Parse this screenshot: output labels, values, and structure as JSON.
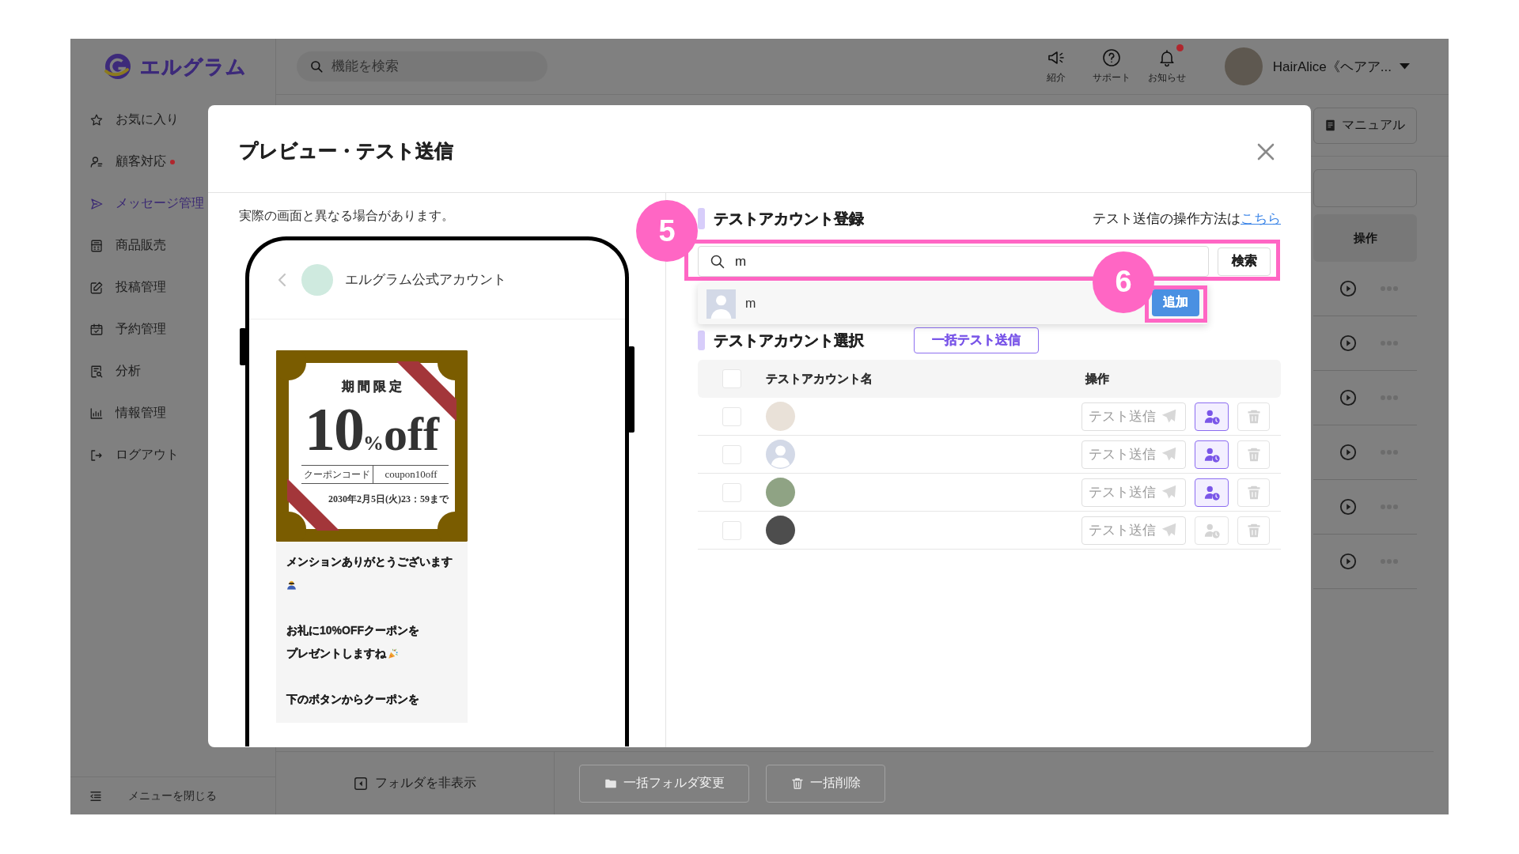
{
  "app": {
    "logo": "エルグラム",
    "search": {
      "placeholder": "機能を検索"
    }
  },
  "header_actions": [
    {
      "label": "紹介",
      "badge": false
    },
    {
      "label": "サポート",
      "badge": false
    },
    {
      "label": "お知らせ",
      "badge": true
    }
  ],
  "account": {
    "name": "HairAlice《ヘアア..."
  },
  "sidebar": {
    "items": [
      {
        "label": "お気に入り",
        "selected": false,
        "alert": false
      },
      {
        "label": "顧客対応",
        "selected": false,
        "alert": true
      },
      {
        "label": "メッセージ管理",
        "selected": true,
        "alert": false
      },
      {
        "label": "商品販売",
        "selected": false,
        "alert": false
      },
      {
        "label": "投稿管理",
        "selected": false,
        "alert": false
      },
      {
        "label": "予約管理",
        "selected": false,
        "alert": false
      },
      {
        "label": "分析",
        "selected": false,
        "alert": false
      },
      {
        "label": "情報管理",
        "selected": false,
        "alert": false
      },
      {
        "label": "ログアウト",
        "selected": false,
        "alert": false
      }
    ],
    "footer": "メニューを閉じる"
  },
  "main": {
    "manual_button": "マニュアル",
    "table": {
      "columns": [
        "操作"
      ],
      "rows": [
        {
          "kind": "message"
        },
        {
          "kind": "message"
        },
        {
          "kind": "message"
        },
        {
          "kind": "message"
        },
        {
          "kind": "message"
        },
        {
          "kind": "message"
        }
      ]
    },
    "footer": {
      "folder_toggle": "フォルダを非表示",
      "bulk_actions": [
        {
          "label": "一括フォルダ変更",
          "disabled": true
        },
        {
          "label": "一括削除",
          "disabled": true
        }
      ]
    }
  },
  "modal": {
    "title": "プレビュー・テスト送信",
    "note": "実際の画面と異なる場合があります。",
    "preview": {
      "account_name": "エルグラム公式アカウント",
      "coupon": {
        "heading": "期間限定",
        "discount": {
          "value": "10",
          "percent": "%",
          "suffix": "off"
        },
        "code_label": "クーポンコード",
        "code": "coupon10off",
        "expiry": "2030年2月5日(火)23：59まで"
      },
      "message": {
        "paragraphs": [
          [
            "メンションありがとうございます"
          ],
          [
            "お礼に10%OFFクーポンを",
            "プレゼントしますね"
          ],
          [
            "下のボタンからクーポンを"
          ]
        ]
      }
    },
    "register": {
      "title": "テストアカウント登録",
      "help_text": "テスト送信の操作方法は",
      "help_link": "こちら",
      "search": {
        "value": "m",
        "button": "検索",
        "step": "5"
      },
      "results": [
        {
          "name": "m",
          "button": "追加",
          "step": "6"
        }
      ]
    },
    "select": {
      "title": "テストアカウント選択",
      "bulk_button": "一括テスト送信",
      "table": {
        "columns": [
          "テストアカウント名",
          "操作"
        ],
        "all_checked": false,
        "rows": [
          {
            "checked": false,
            "avatar": {
              "kind": "photo"
            },
            "send_button": {
              "label": "テスト送信",
              "disabled": true
            },
            "schedule_disabled": false,
            "delete_disabled": true
          },
          {
            "checked": false,
            "avatar": {
              "kind": "default"
            },
            "send_button": {
              "label": "テスト送信",
              "disabled": true
            },
            "schedule_disabled": false,
            "delete_disabled": true
          },
          {
            "checked": false,
            "avatar": {
              "kind": "photo"
            },
            "send_button": {
              "label": "テスト送信",
              "disabled": true
            },
            "schedule_disabled": false,
            "delete_disabled": true
          },
          {
            "checked": false,
            "avatar": {
              "kind": "photo"
            },
            "send_button": {
              "label": "テスト送信",
              "disabled": true
            },
            "schedule_disabled": true,
            "delete_disabled": true
          }
        ]
      }
    }
  }
}
